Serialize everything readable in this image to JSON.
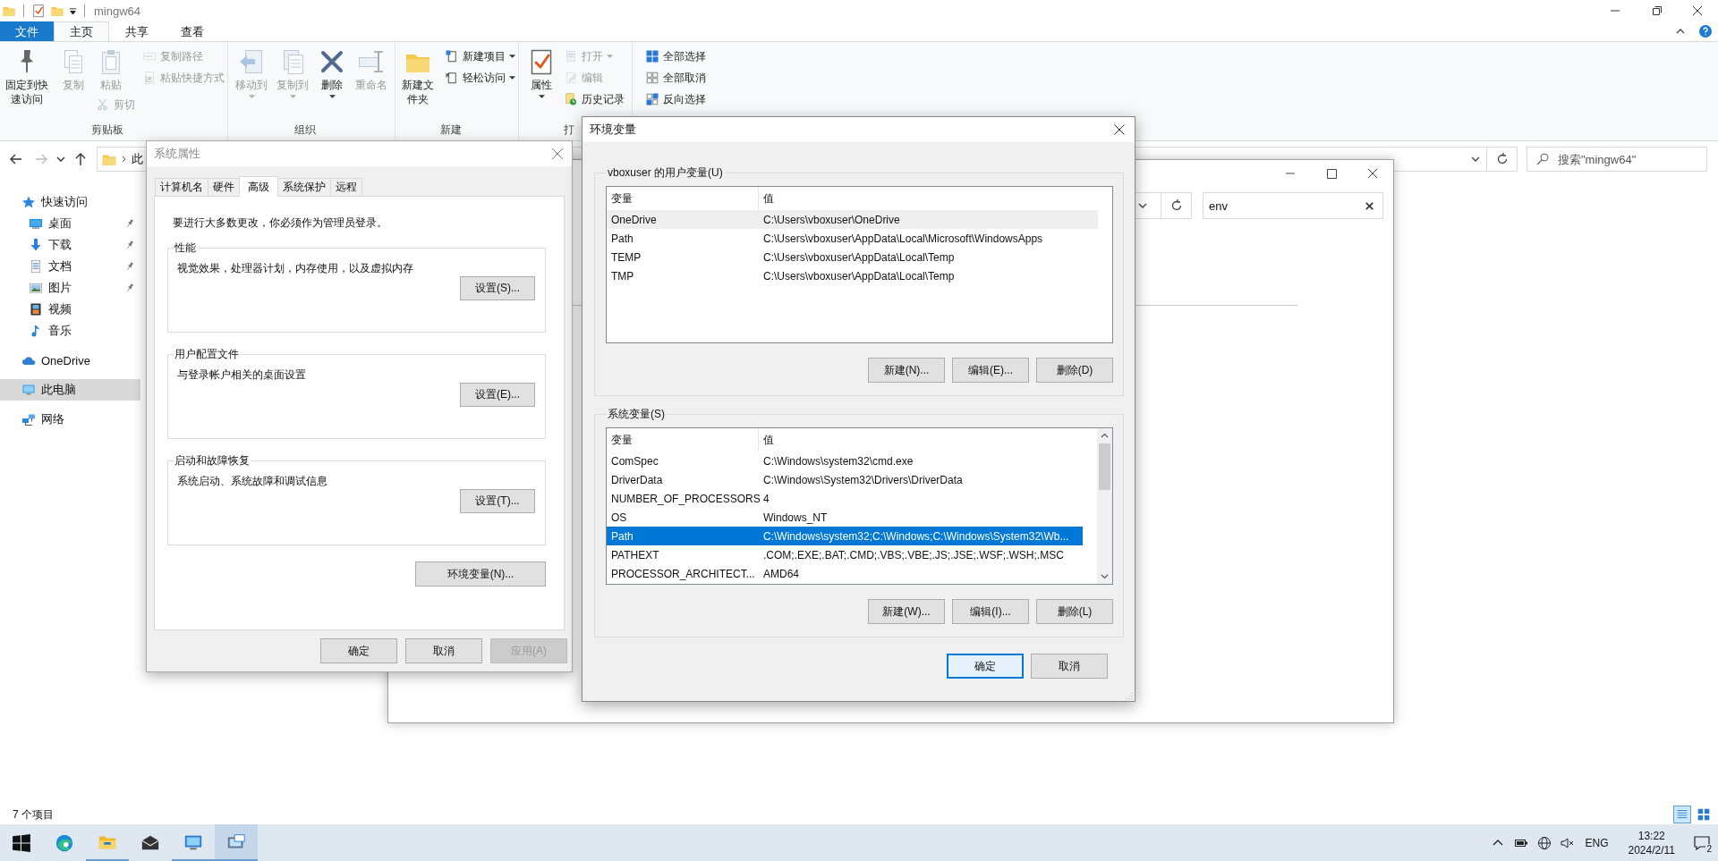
{
  "explorer": {
    "title": "mingw64",
    "ribbon_tabs": [
      {
        "label": "文件",
        "kind": "file",
        "selected": false
      },
      {
        "label": "主页",
        "kind": "tab",
        "selected": true
      },
      {
        "label": "共享",
        "kind": "tab",
        "selected": false
      },
      {
        "label": "查看",
        "kind": "tab",
        "selected": false
      }
    ],
    "ribbon_groups": [
      {
        "label": "剪贴板",
        "columns": [
          [
            {
              "label": "固定到快速访问",
              "kind": "large",
              "disabled": false,
              "menu": false
            }
          ],
          [
            {
              "label": "复制",
              "kind": "large",
              "disabled": true,
              "menu": false
            }
          ],
          [
            {
              "label": "粘贴",
              "kind": "large",
              "disabled": true,
              "menu": false
            },
            {
              "label": "剪切",
              "kind": "small",
              "disabled": true,
              "menu": false
            }
          ],
          [
            {
              "label": "复制路径",
              "kind": "small",
              "disabled": true,
              "menu": false
            },
            {
              "label": "粘贴快捷方式",
              "kind": "small",
              "disabled": true,
              "menu": false
            }
          ]
        ]
      },
      {
        "label": "组织",
        "columns": [
          [
            {
              "label": "移动到",
              "kind": "large",
              "disabled": true,
              "menu": true
            }
          ],
          [
            {
              "label": "复制到",
              "kind": "large",
              "disabled": true,
              "menu": true
            }
          ],
          [
            {
              "label": "删除",
              "kind": "large",
              "disabled": false,
              "menu": true
            }
          ],
          [
            {
              "label": "重命名",
              "kind": "large",
              "disabled": true,
              "menu": false
            }
          ]
        ]
      },
      {
        "label": "新建",
        "columns": [
          [
            {
              "label": "新建文件夹",
              "kind": "large",
              "disabled": false,
              "menu": false
            }
          ],
          [
            {
              "label": "新建项目",
              "kind": "small",
              "disabled": false,
              "menu": true
            },
            {
              "label": "轻松访问",
              "kind": "small",
              "disabled": false,
              "menu": true
            }
          ]
        ]
      },
      {
        "label": "打",
        "columns": [
          [
            {
              "label": "属性",
              "kind": "large",
              "disabled": false,
              "menu": true
            }
          ],
          [
            {
              "label": "打开",
              "kind": "small",
              "disabled": true,
              "menu": true
            },
            {
              "label": "编辑",
              "kind": "small",
              "disabled": true,
              "menu": false
            },
            {
              "label": "历史记录",
              "kind": "small",
              "disabled": false,
              "menu": false
            }
          ]
        ]
      },
      {
        "columns": [
          [
            {
              "label": "全部选择",
              "kind": "small",
              "disabled": false,
              "menu": false
            },
            {
              "label": "全部取消",
              "kind": "small",
              "disabled": false,
              "menu": false
            },
            {
              "label": "反向选择",
              "kind": "small",
              "disabled": false,
              "menu": false
            }
          ]
        ]
      }
    ],
    "nav_buttons": [
      {
        "kind": "back",
        "disabled": false
      },
      {
        "kind": "forward",
        "disabled": true
      },
      {
        "kind": "recent",
        "disabled": false
      },
      {
        "kind": "up",
        "disabled": false
      }
    ],
    "address": "此",
    "search_placeholder": "搜索\"mingw64\"",
    "sidebar": [
      {
        "label": "快速访问",
        "selected": false,
        "children": [
          {
            "label": "桌面",
            "pinned": true,
            "selected": false
          },
          {
            "label": "下载",
            "pinned": true,
            "selected": false
          },
          {
            "label": "文档",
            "pinned": true,
            "selected": false
          },
          {
            "label": "图片",
            "pinned": true,
            "selected": false
          },
          {
            "label": "视频",
            "pinned": false,
            "selected": false
          },
          {
            "label": "音乐",
            "pinned": false,
            "selected": false
          }
        ]
      },
      {
        "label": "OneDrive",
        "selected": false
      },
      {
        "label": "此电脑",
        "selected": true
      },
      {
        "label": "网络",
        "selected": false
      }
    ],
    "status": "7 个项目",
    "views": [
      {
        "kind": "details",
        "selected": true
      },
      {
        "kind": "large_icons",
        "selected": false
      }
    ]
  },
  "search_window": {
    "search_value": "env"
  },
  "system_properties": {
    "title": "系统属性",
    "tabs": [
      {
        "label": "计算机名",
        "selected": false
      },
      {
        "label": "硬件",
        "selected": false
      },
      {
        "label": "高级",
        "selected": true
      },
      {
        "label": "系统保护",
        "selected": false
      },
      {
        "label": "远程",
        "selected": false
      }
    ],
    "notice": "要进行大多数更改，你必须作为管理员登录。",
    "groups": [
      {
        "label": "性能",
        "description": "视觉效果，处理器计划，内存使用，以及虚拟内存",
        "button": "设置(S)..."
      },
      {
        "label": "用户配置文件",
        "description": "与登录帐户相关的桌面设置",
        "button": "设置(E)..."
      },
      {
        "label": "启动和故障恢复",
        "description": "系统启动、系统故障和调试信息",
        "button": "设置(T)..."
      }
    ],
    "env_button": "环境变量(N)...",
    "buttons": [
      {
        "label": "确定",
        "disabled": false
      },
      {
        "label": "取消",
        "disabled": false
      },
      {
        "label": "应用(A)",
        "disabled": true
      }
    ]
  },
  "environment_variables": {
    "title": "环境变量",
    "lists": [
      {
        "label": "vboxuser 的用户变量(U)",
        "focused": false,
        "columns": [
          "变量",
          "值"
        ],
        "rows": [
          {
            "name": "OneDrive",
            "value": "C:\\Users\\vboxuser\\OneDrive",
            "selected": true
          },
          {
            "name": "Path",
            "value": "C:\\Users\\vboxuser\\AppData\\Local\\Microsoft\\WindowsApps",
            "selected": false
          },
          {
            "name": "TEMP",
            "value": "C:\\Users\\vboxuser\\AppData\\Local\\Temp",
            "selected": false
          },
          {
            "name": "TMP",
            "value": "C:\\Users\\vboxuser\\AppData\\Local\\Temp",
            "selected": false
          }
        ],
        "buttons": [
          "新建(N)...",
          "编辑(E)...",
          "删除(D)"
        ]
      },
      {
        "label": "系统变量(S)",
        "focused": true,
        "columns": [
          "变量",
          "值"
        ],
        "rows": [
          {
            "name": "ComSpec",
            "value": "C:\\Windows\\system32\\cmd.exe",
            "selected": false
          },
          {
            "name": "DriverData",
            "value": "C:\\Windows\\System32\\Drivers\\DriverData",
            "selected": false
          },
          {
            "name": "NUMBER_OF_PROCESSORS",
            "value": "4",
            "selected": false
          },
          {
            "name": "OS",
            "value": "Windows_NT",
            "selected": false
          },
          {
            "name": "Path",
            "value": "C:\\Windows\\system32;C:\\Windows;C:\\Windows\\System32\\Wb...",
            "selected": true
          },
          {
            "name": "PATHEXT",
            "value": ".COM;.EXE;.BAT;.CMD;.VBS;.VBE;.JS;.JSE;.WSF;.WSH;.MSC",
            "selected": false
          },
          {
            "name": "PROCESSOR_ARCHITECT...",
            "value": "AMD64",
            "selected": false
          }
        ],
        "buttons": [
          "新建(W)...",
          "编辑(I)...",
          "删除(L)"
        ]
      }
    ],
    "buttons": [
      {
        "label": "确定",
        "default": true
      },
      {
        "label": "取消",
        "default": false
      }
    ]
  },
  "taskbar": {
    "apps": [
      {
        "kind": "start",
        "running": false,
        "active": false
      },
      {
        "kind": "browser",
        "running": false,
        "active": false
      },
      {
        "kind": "explorer",
        "running": true,
        "active": false
      },
      {
        "kind": "mail",
        "running": false,
        "active": false
      },
      {
        "kind": "sysprops",
        "running": true,
        "active": false
      },
      {
        "kind": "envvars",
        "running": true,
        "active": true
      }
    ],
    "language": "ENG",
    "time": "13:22",
    "date": "2024/2/11",
    "notifications": "2"
  }
}
